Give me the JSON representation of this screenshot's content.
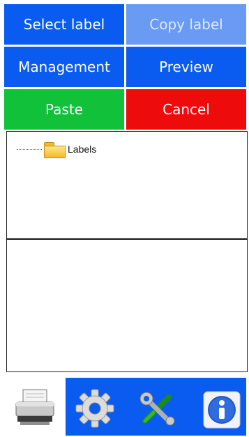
{
  "buttons": {
    "select_label": "Select label",
    "copy_label": "Copy label",
    "management": "Management",
    "preview": "Preview",
    "paste": "Paste",
    "cancel": "Cancel"
  },
  "tree": {
    "root_label": "Labels",
    "root_icon": "folder-icon"
  },
  "toolbar": {
    "icons": [
      "printer-icon",
      "gear-icon",
      "tools-icon",
      "info-icon"
    ]
  },
  "colors": {
    "blue": "#0a5cf0",
    "blue_disabled": "#6a9bf4",
    "green": "#11c13a",
    "red": "#ee0b0b"
  }
}
